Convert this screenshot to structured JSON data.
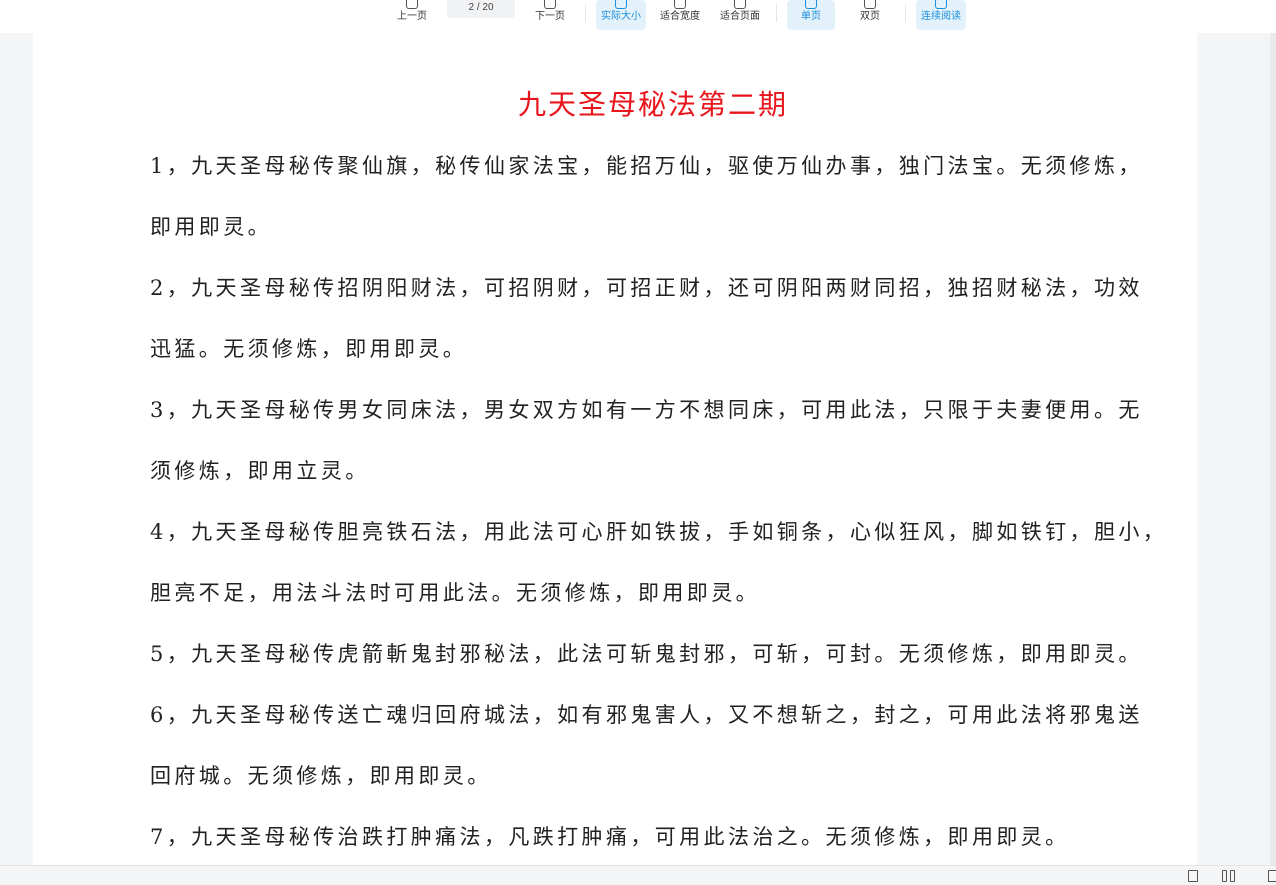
{
  "toolbar": {
    "prev_page": "上一页",
    "page_indicator": "2 / 20",
    "next_page": "下一页",
    "actual_size": "实际大小",
    "fit_width": "适合宽度",
    "fit_page": "适合页面",
    "single_page": "单页",
    "double_page": "双页",
    "continuous_read": "连续阅读",
    "accent_color": "#1a8fdc"
  },
  "document": {
    "title": "九天圣母秘法第二期",
    "title_color": "#e8161c",
    "lines": [
      "1，九天圣母秘传聚仙旗，秘传仙家法宝，能招万仙，驱使万仙办事，独门法宝。无须修炼，",
      "即用即灵。",
      "2，九天圣母秘传招阴阳财法，可招阴财，可招正财，还可阴阳两财同招，独招财秘法，功效",
      "迅猛。无须修炼，即用即灵。",
      "3，九天圣母秘传男女同床法，男女双方如有一方不想同床，可用此法，只限于夫妻便用。无",
      "须修炼，即用立灵。",
      "4，九天圣母秘传胆亮铁石法，用此法可心肝如铁拔，手如铜条，心似狂风，脚如铁钉，胆小，",
      "胆亮不足，用法斗法时可用此法。无须修炼，即用即灵。",
      "5，九天圣母秘传虎箭斬鬼封邪秘法，此法可斩鬼封邪，可斩，可封。无须修炼，即用即灵。",
      "6，九天圣母秘传送亡魂归回府城法，如有邪鬼害人，又不想斩之，封之，可用此法将邪鬼送",
      "回府城。无须修炼，即用即灵。",
      "7，九天圣母秘传治跌打肿痛法，凡跌打肿痛，可用此法治之。无须修炼，即用即灵。"
    ]
  },
  "statusbar": {
    "icons": [
      "single-page-view-icon",
      "double-page-view-icon",
      "continuous-view-icon"
    ]
  }
}
